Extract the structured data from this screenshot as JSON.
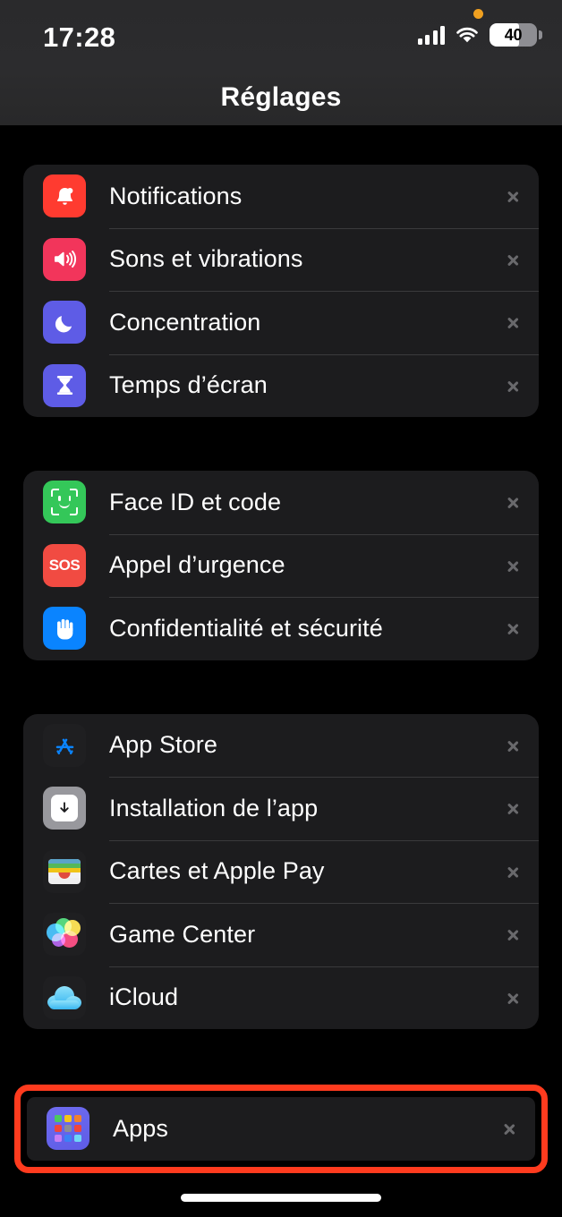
{
  "status_bar": {
    "time": "17:28",
    "battery_level": "40",
    "icons": [
      "privacy-dot-icon",
      "cellular-signal-icon",
      "wifi-icon",
      "battery-icon"
    ]
  },
  "header": {
    "title": "Réglages"
  },
  "colors": {
    "page_background": "#000000",
    "card_background": "#1C1C1E",
    "separator": "#3A3A3C",
    "label": "#FFFFFF",
    "chevron": "#98989D",
    "highlight": "#FF3B1E"
  },
  "groups": [
    {
      "rows": [
        {
          "label": "Notifications",
          "icon": "bell-icon",
          "icon_color": "#FF3B30"
        },
        {
          "label": "Sons et vibrations",
          "icon": "speaker-icon",
          "icon_color": "#F2355B"
        },
        {
          "label": "Concentration",
          "icon": "moon-icon",
          "icon_color": "#5E5CE6"
        },
        {
          "label": "Temps d’écran",
          "icon": "hourglass-icon",
          "icon_color": "#5E5CE6"
        }
      ]
    },
    {
      "rows": [
        {
          "label": "Face ID et code",
          "icon": "face-id-icon",
          "icon_color": "#34C759"
        },
        {
          "label": "Appel d’urgence",
          "icon": "sos-icon",
          "icon_color": "#F14B42"
        },
        {
          "label": "Confidentialité et sécurité",
          "icon": "hand-icon",
          "icon_color": "#0A84FF"
        }
      ]
    },
    {
      "rows": [
        {
          "label": "App Store",
          "icon": "app-store-icon",
          "icon_color": "#1F1F21"
        },
        {
          "label": "Installation de l’app",
          "icon": "download-icon",
          "icon_color": "#98989D"
        },
        {
          "label": "Cartes et Apple Pay",
          "icon": "wallet-icon",
          "icon_color": "#1F1F21"
        },
        {
          "label": "Game Center",
          "icon": "game-center-icon",
          "icon_color": "#1F1F21"
        },
        {
          "label": "iCloud",
          "icon": "icloud-icon",
          "icon_color": "#1F1F21"
        }
      ]
    }
  ],
  "highlighted_row": {
    "label": "Apps",
    "icon": "apps-grid-icon",
    "icon_color": "#5E5CE6",
    "grid_colors": [
      "#4CC95E",
      "#F5C518",
      "#F08030",
      "#F0453A",
      "#8E8E93",
      "#F0453A",
      "#C77DF5",
      "#3B82F6",
      "#6FD8F5"
    ]
  },
  "home_indicator": {
    "present": true
  }
}
